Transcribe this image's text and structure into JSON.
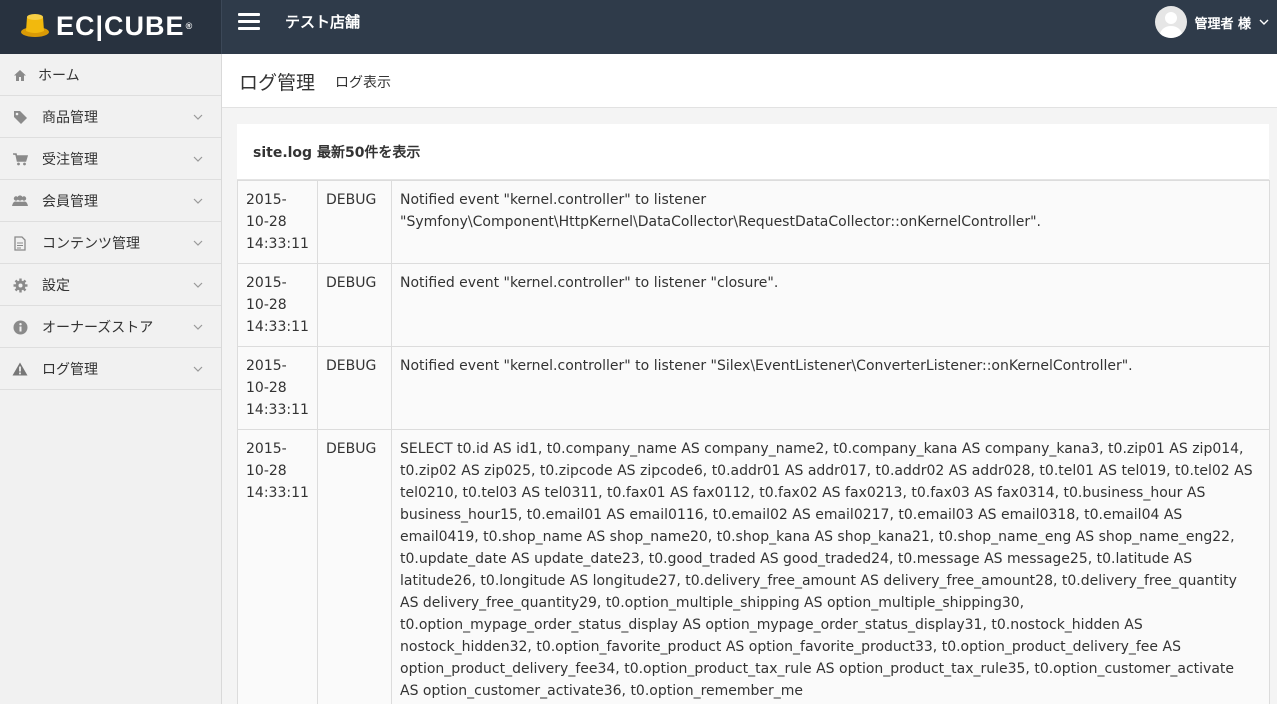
{
  "header": {
    "logo_text": "EC|CUBE",
    "logo_mark": "®",
    "shop_name": "テスト店舗",
    "user_name": "管理者 様"
  },
  "sidebar": {
    "items": [
      {
        "label": "ホーム",
        "icon": "home-icon"
      },
      {
        "label": "商品管理",
        "icon": "tag-icon"
      },
      {
        "label": "受注管理",
        "icon": "cart-icon"
      },
      {
        "label": "会員管理",
        "icon": "users-icon"
      },
      {
        "label": "コンテンツ管理",
        "icon": "document-icon"
      },
      {
        "label": "設定",
        "icon": "gear-icon"
      },
      {
        "label": "オーナーズストア",
        "icon": "info-icon"
      },
      {
        "label": "ログ管理",
        "icon": "warning-icon"
      }
    ]
  },
  "page": {
    "title": "ログ管理",
    "subtitle": "ログ表示"
  },
  "panel": {
    "heading": "site.log 最新50件を表示"
  },
  "log_rows": [
    {
      "date": "2015-\n10-28\n14:33:11",
      "level": "DEBUG",
      "message": "Notified event \"kernel.controller\" to listener \"Symfony\\Component\\HttpKernel\\DataCollector\\RequestDataCollector::onKernelController\"."
    },
    {
      "date": "2015-\n10-28\n14:33:11",
      "level": "DEBUG",
      "message": "Notified event \"kernel.controller\" to listener \"closure\"."
    },
    {
      "date": "2015-\n10-28\n14:33:11",
      "level": "DEBUG",
      "message": "Notified event \"kernel.controller\" to listener \"Silex\\EventListener\\ConverterListener::onKernelController\"."
    },
    {
      "date": "2015-\n10-28\n14:33:11",
      "level": "DEBUG",
      "message": "SELECT t0.id AS id1, t0.company_name AS company_name2, t0.company_kana AS company_kana3, t0.zip01 AS zip014, t0.zip02 AS zip025, t0.zipcode AS zipcode6, t0.addr01 AS addr017, t0.addr02 AS addr028, t0.tel01 AS tel019, t0.tel02 AS tel0210, t0.tel03 AS tel0311, t0.fax01 AS fax0112, t0.fax02 AS fax0213, t0.fax03 AS fax0314, t0.business_hour AS business_hour15, t0.email01 AS email0116, t0.email02 AS email0217, t0.email03 AS email0318, t0.email04 AS email0419, t0.shop_name AS shop_name20, t0.shop_kana AS shop_kana21, t0.shop_name_eng AS shop_name_eng22, t0.update_date AS update_date23, t0.good_traded AS good_traded24, t0.message AS message25, t0.latitude AS latitude26, t0.longitude AS longitude27, t0.delivery_free_amount AS delivery_free_amount28, t0.delivery_free_quantity AS delivery_free_quantity29, t0.option_multiple_shipping AS option_multiple_shipping30, t0.option_mypage_order_status_display AS option_mypage_order_status_display31, t0.nostock_hidden AS nostock_hidden32, t0.option_favorite_product AS option_favorite_product33, t0.option_product_delivery_fee AS option_product_delivery_fee34, t0.option_product_tax_rule AS option_product_tax_rule35, t0.option_customer_activate AS option_customer_activate36, t0.option_remember_me"
    }
  ],
  "colors": {
    "topbar": "#2f3b4a",
    "logo_gold": "#f2b90d"
  }
}
